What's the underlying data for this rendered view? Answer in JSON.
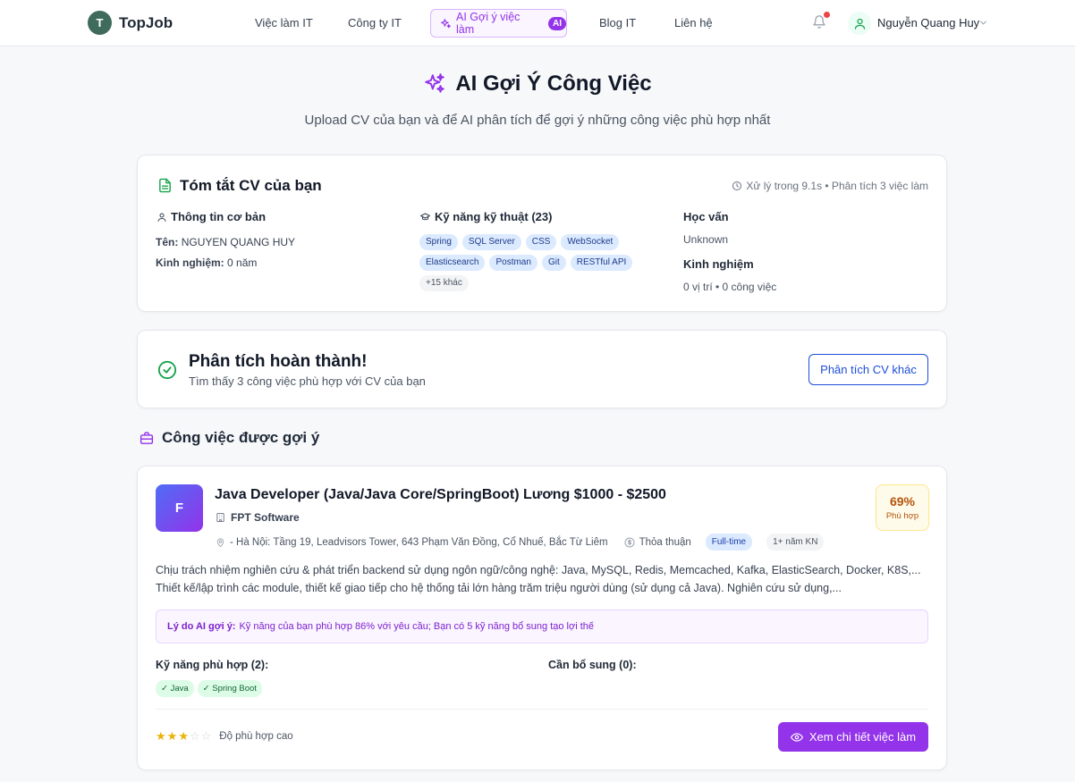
{
  "header": {
    "logo_letter": "T",
    "logo_text": "TopJob",
    "nav": [
      {
        "label": "Việc làm IT"
      },
      {
        "label": "Công ty IT"
      },
      {
        "label": "AI Gợi ý việc làm",
        "badge": "AI",
        "active": true
      },
      {
        "label": "Blog IT"
      },
      {
        "label": "Liên hệ"
      }
    ],
    "user_name": "Nguyễn Quang Huy"
  },
  "page": {
    "title": "AI Gợi Ý Công Việc",
    "subtitle": "Upload CV của bạn và để AI phân tích để gợi ý những công việc phù hợp nhất"
  },
  "cv_summary": {
    "title": "Tóm tắt CV của bạn",
    "meta": "Xử lý trong 9.1s • Phân tích 3 việc làm",
    "basic_info": {
      "heading": "Thông tin cơ bản",
      "name_label": "Tên:",
      "name_value": "NGUYEN QUANG HUY",
      "exp_label": "Kinh nghiệm:",
      "exp_value": "0 năm"
    },
    "skills": {
      "heading": "Kỹ năng kỹ thuật (23)",
      "items": [
        "Spring",
        "SQL Server",
        "CSS",
        "WebSocket",
        "Elasticsearch",
        "Postman",
        "Git",
        "RESTful API"
      ],
      "more": "+15 khác"
    },
    "education": {
      "heading": "Học vấn",
      "value": "Unknown"
    },
    "experience": {
      "heading": "Kinh nghiệm",
      "value": "0 vị trí • 0 công việc"
    }
  },
  "analysis": {
    "title": "Phân tích hoàn thành!",
    "subtitle": "Tìm thấy 3 công việc phù hợp với CV của bạn",
    "button": "Phân tích CV khác"
  },
  "recommended": {
    "title": "Công việc được gợi ý",
    "jobs": [
      {
        "logo_letter": "F",
        "title": "Java Developer (Java/Java Core/SpringBoot) Lương $1000 - $2500",
        "company": "FPT Software",
        "location": "- Hà Nội: Tầng 19, Leadvisors Tower, 643 Phạm Văn Đồng, Cổ Nhuế, Bắc Từ Liêm",
        "salary": "Thỏa thuận",
        "job_type": "Full-time",
        "experience": "1+ năm KN",
        "match_percent": "69%",
        "match_label": "Phù hợp",
        "description": "Chịu trách nhiệm nghiên cứu & phát triển backend sử dụng ngôn ngữ/công nghệ: Java, MySQL, Redis, Memcached, Kafka, ElasticSearch, Docker, K8S,... Thiết kế/lập trình các module, thiết kế giao tiếp cho hệ thống tải lớn hàng trăm triệu người dùng (sử dụng cả Java). Nghiên cứu sử dụng,...",
        "reason_label": "Lý do AI gợi ý:",
        "reason_text": "Kỹ năng của bạn phù hợp 86% với yêu cầu; Bạn có 5 kỹ năng bổ sung tạo lợi thế",
        "matched_skills_heading": "Kỹ năng phù hợp (2):",
        "matched_skills": [
          "✓ Java",
          "✓ Spring Boot"
        ],
        "missing_skills_heading": "Cần bổ sung (0):",
        "rating": 3,
        "rating_max": 5,
        "rating_label": "Độ phù hợp cao",
        "detail_button": "Xem chi tiết việc làm"
      }
    ]
  },
  "colors": {
    "accent": "#9333ea",
    "logo_bg": "#3f6b5c",
    "link_blue": "#1d4ed8",
    "success": "#16a34a",
    "match_amber": "#b45309"
  }
}
